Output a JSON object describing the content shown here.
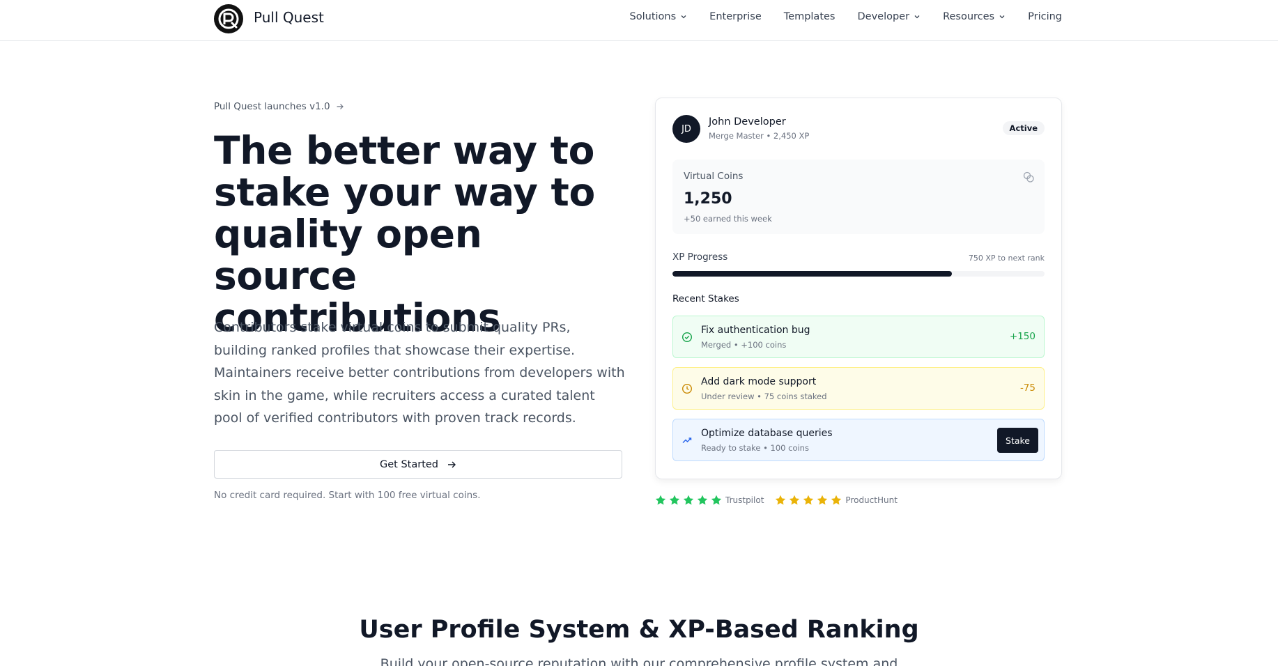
{
  "header": {
    "brand": "Pull Quest",
    "nav": [
      {
        "label": "Solutions",
        "has_menu": true
      },
      {
        "label": "Enterprise",
        "has_menu": false
      },
      {
        "label": "Templates",
        "has_menu": false
      },
      {
        "label": "Developer",
        "has_menu": true
      },
      {
        "label": "Resources",
        "has_menu": true
      },
      {
        "label": "Pricing",
        "has_menu": false
      }
    ]
  },
  "hero": {
    "announcement": "Pull Quest launches v1.0",
    "title": "The better way to stake your way to quality open source contributions",
    "description": "Contributors stake virtual coins to submit quality PRs, building ranked profiles that showcase their expertise. Maintainers receive better contributions from developers with skin in the game, while recruiters access a curated talent pool of verified contributors with proven track records.",
    "cta_label": "Get Started",
    "fineprint": "No credit card required. Start with 100 free virtual coins."
  },
  "profile_card": {
    "avatar_initials": "JD",
    "user_name": "John Developer",
    "user_subtitle": "Merge Master • 2,450 XP",
    "status_badge": "Active",
    "coins": {
      "label": "Virtual Coins",
      "value": "1,250",
      "subtitle": "+50 earned this week",
      "icon": "coins-icon"
    },
    "xp": {
      "label": "XP Progress",
      "next_rank": "750 XP to next rank",
      "progress_fraction": 0.75
    },
    "recent_label": "Recent Stakes",
    "stakes": [
      {
        "title": "Fix authentication bug",
        "subtitle": "Merged • +100 coins",
        "amount": "+150",
        "icon": "check-circle-icon",
        "status": "merged"
      },
      {
        "title": "Add dark mode support",
        "subtitle": "Under review • 75 coins staked",
        "amount": "-75",
        "icon": "clock-icon",
        "status": "review"
      },
      {
        "title": "Optimize database queries",
        "subtitle": "Ready to stake • 100 coins",
        "button": "Stake",
        "icon": "trending-up-icon",
        "status": "ready"
      }
    ]
  },
  "ratings": [
    {
      "source": "Trustpilot",
      "stars": 5,
      "color": "#22c55e"
    },
    {
      "source": "ProductHunt",
      "stars": 5,
      "color": "#eab308"
    }
  ],
  "section": {
    "title": "User Profile System & XP-Based Ranking",
    "subtitle": "Build your open-source reputation with our comprehensive profile system and"
  },
  "colors": {
    "merged_bg": "#f0fdf4",
    "merged_border": "#bbf7d0",
    "merged_text": "#16a34a",
    "review_bg": "#fefce8",
    "review_border": "#fef08a",
    "review_text": "#ca8a04",
    "ready_bg": "#eff6ff",
    "ready_border": "#bfdbfe",
    "ready_text": "#2563eb"
  }
}
